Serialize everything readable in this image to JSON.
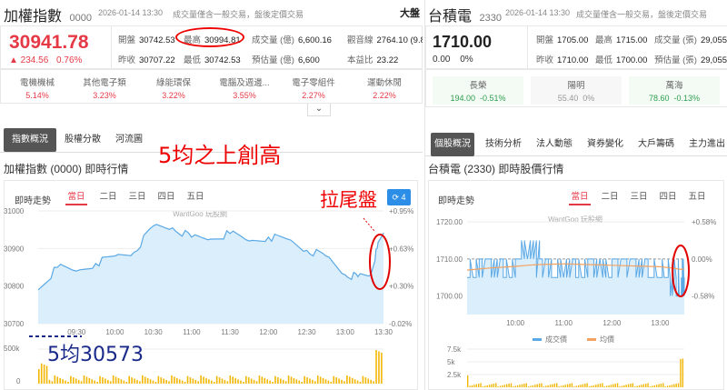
{
  "left": {
    "header": {
      "title": "加權指數",
      "code": "0000",
      "timestamp": "2026-01-14 13:30",
      "note": "成交量僅含一般交易，盤後定價交易",
      "overflow_text": "大盤"
    },
    "quote": {
      "price": "30941.78",
      "change": "▲ 234.56",
      "change_pct": "0.76%"
    },
    "stats": [
      {
        "label": "開盤",
        "value": "30742.53"
      },
      {
        "label": "最高",
        "value": "30994.81"
      },
      {
        "label": "成交量 (億)",
        "value": "6,600.16"
      },
      {
        "label": "觀音線",
        "value": "2764.10 (9.81"
      },
      {
        "label": "昨收",
        "value": "30707.22"
      },
      {
        "label": "最低",
        "value": "30742.53"
      },
      {
        "label": "預估量 (億)",
        "value": "6,600"
      },
      {
        "label": "本益比",
        "value": "23.22"
      }
    ],
    "sectors": [
      {
        "name": "電機機械",
        "pct": "5.14%"
      },
      {
        "name": "其他電子類",
        "pct": "3.23%"
      },
      {
        "name": "綠能環保",
        "pct": "3.22%"
      },
      {
        "name": "電腦及週邊...",
        "pct": "3.55%"
      },
      {
        "name": "電子零組件",
        "pct": "2.27%"
      },
      {
        "name": "運動休閒",
        "pct": "2.22%"
      }
    ],
    "tabs": [
      "指數概況",
      "股權分散",
      "河流圖"
    ],
    "section_title": "加權指數 (0000) 即時行情",
    "chart_heading": "即時走勢",
    "periods": [
      "當日",
      "二日",
      "三日",
      "四日",
      "五日"
    ],
    "refresh_count": "4",
    "watermark": "WantGoo 玩股網",
    "annotations": {
      "headline": "5均之上創高",
      "tail": "拉尾盤",
      "ma": "5均30573"
    }
  },
  "right": {
    "header": {
      "title": "台積電",
      "code": "2330",
      "timestamp": "2026-01-14 13:30",
      "note": "成交量僅含一般交易，盤後定價交易"
    },
    "quote": {
      "price": "1710.00",
      "change": "0.00",
      "change_pct": "0%"
    },
    "stats": [
      {
        "label": "開盤",
        "value": "1705.00"
      },
      {
        "label": "最高",
        "value": "1715.00"
      },
      {
        "label": "成交量 (張)",
        "value": "29,055"
      },
      {
        "label": "昨收",
        "value": "1710.00"
      },
      {
        "label": "最低",
        "value": "1700.00"
      },
      {
        "label": "預估量 (張)",
        "value": "29,055"
      }
    ],
    "peers": [
      {
        "name": "長榮",
        "price": "194.00",
        "pct": "-0.51%"
      },
      {
        "name": "陽明",
        "price": "55.40",
        "pct": "0%"
      },
      {
        "name": "萬海",
        "price": "78.60",
        "pct": "-0.13%"
      }
    ],
    "tabs": [
      "個股概況",
      "技術分析",
      "法人動態",
      "資券變化",
      "大戶籌碼",
      "主力進出"
    ],
    "section_title": "台積電 (2330) 即時股價行情",
    "chart_heading": "即時走勢",
    "periods": [
      "當日",
      "二日",
      "三日",
      "四日",
      "五日"
    ],
    "watermark": "WantGoo 玩股網",
    "legend": [
      "成交價",
      "均價"
    ]
  },
  "colors": {
    "up": "#e63946",
    "down": "#2e9e4f",
    "line": "#5aa9e6",
    "area": "#dbeefb",
    "avg": "#f4a261",
    "volume": "#f2b705",
    "annotation": "#e00000"
  },
  "chart_data": [
    {
      "type": "area",
      "title": "加權指數即時走勢",
      "x": [
        "09:00",
        "09:15",
        "09:30",
        "09:45",
        "10:00",
        "10:15",
        "10:30",
        "10:45",
        "11:00",
        "11:15",
        "11:30",
        "11:45",
        "12:00",
        "12:15",
        "12:30",
        "12:45",
        "13:00",
        "13:10",
        "13:20",
        "13:25",
        "13:30"
      ],
      "series": [
        {
          "values": [
            30790,
            30850,
            30840,
            30860,
            30880,
            30890,
            30960,
            30955,
            30930,
            30925,
            30940,
            30920,
            30930,
            30925,
            30895,
            30880,
            30830,
            30825,
            30830,
            30900,
            30942
          ]
        }
      ],
      "x_ticks": [
        "09:30",
        "10:00",
        "10:30",
        "11:00",
        "11:30",
        "12:00",
        "12:30",
        "13:00",
        "13:30"
      ],
      "y_ticks": [
        "31000",
        "30900",
        "30800",
        "30700"
      ],
      "y2_ticks": [
        "+0.95%",
        "+0.63%",
        "+0.30%",
        "-0.02%"
      ],
      "ylim": [
        30700,
        31000
      ],
      "volume": {
        "y_ticks": [
          "500k",
          "0"
        ],
        "ylim": [
          0,
          500000
        ]
      }
    },
    {
      "type": "line",
      "title": "台積電即時走勢",
      "x": [
        "09:00",
        "09:15",
        "09:30",
        "09:45",
        "10:00",
        "10:15",
        "10:30",
        "10:45",
        "11:00",
        "11:15",
        "11:30",
        "11:45",
        "12:00",
        "12:15",
        "12:30",
        "12:45",
        "13:00",
        "13:10",
        "13:20",
        "13:25",
        "13:30"
      ],
      "series": [
        {
          "name": "成交價",
          "values": [
            1705,
            1710,
            1710,
            1705,
            1710,
            1715,
            1710,
            1705,
            1710,
            1705,
            1710,
            1705,
            1710,
            1710,
            1710,
            1705,
            1705,
            1705,
            1700,
            1700,
            1710
          ]
        },
        {
          "name": "均價",
          "values": [
            1707,
            1707.3,
            1707.6,
            1707.8,
            1708,
            1708.3,
            1708.5,
            1708.6,
            1708.7,
            1708.6,
            1708.5,
            1708.4,
            1708.3,
            1708.2,
            1708.1,
            1708,
            1707.9,
            1707.7,
            1707.4,
            1707.2,
            1707.3
          ]
        }
      ],
      "x_ticks": [
        "10:00",
        "11:00",
        "12:00",
        "13:00"
      ],
      "y_ticks": [
        "1720.00",
        "1710.00",
        "1700.00"
      ],
      "y2_ticks": [
        "+0.58%",
        "0.00%",
        "-0.58%"
      ],
      "ylim": [
        1695,
        1722
      ],
      "volume": {
        "y_ticks": [
          "7.5k",
          "5k",
          "2.5k"
        ],
        "ylim": [
          0,
          7500
        ]
      }
    }
  ]
}
